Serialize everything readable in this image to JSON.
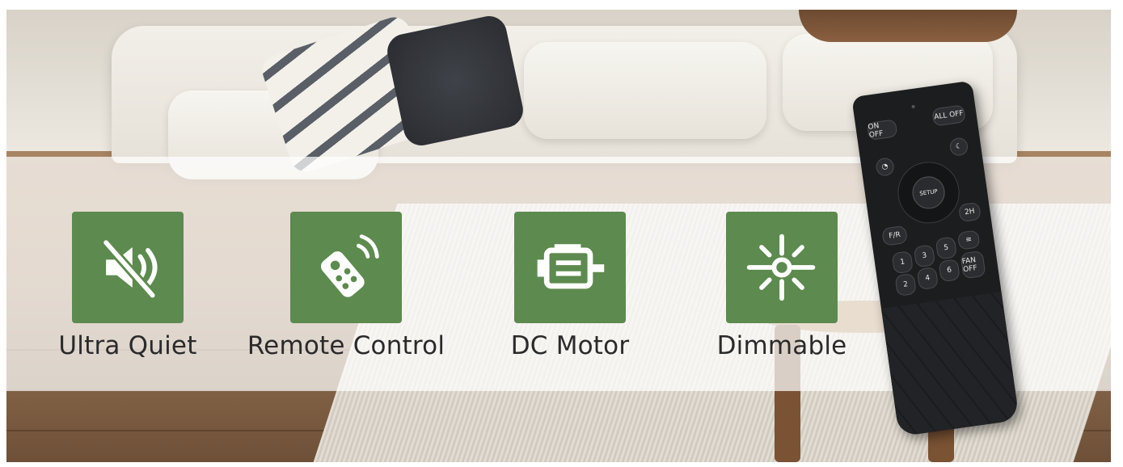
{
  "features": [
    {
      "label": "Ultra Quiet",
      "icon": "muted-speaker-icon"
    },
    {
      "label": "Remote Control",
      "icon": "remote-control-icon"
    },
    {
      "label": "DC Motor",
      "icon": "motor-icon"
    },
    {
      "label": "Dimmable",
      "icon": "dimmer-light-icon"
    }
  ],
  "remote": {
    "on_off": "ON OFF",
    "all_off": "ALL OFF",
    "setup": "SETUP",
    "two_h": "2H",
    "fr": "F/R",
    "fan_off": "FAN OFF",
    "speeds": [
      "1",
      "2",
      "3",
      "4",
      "5",
      "6"
    ]
  },
  "colors": {
    "icon_background": "#5d8a4e",
    "label_text": "#2a2a2a",
    "remote_body": "#1c1d1f"
  }
}
